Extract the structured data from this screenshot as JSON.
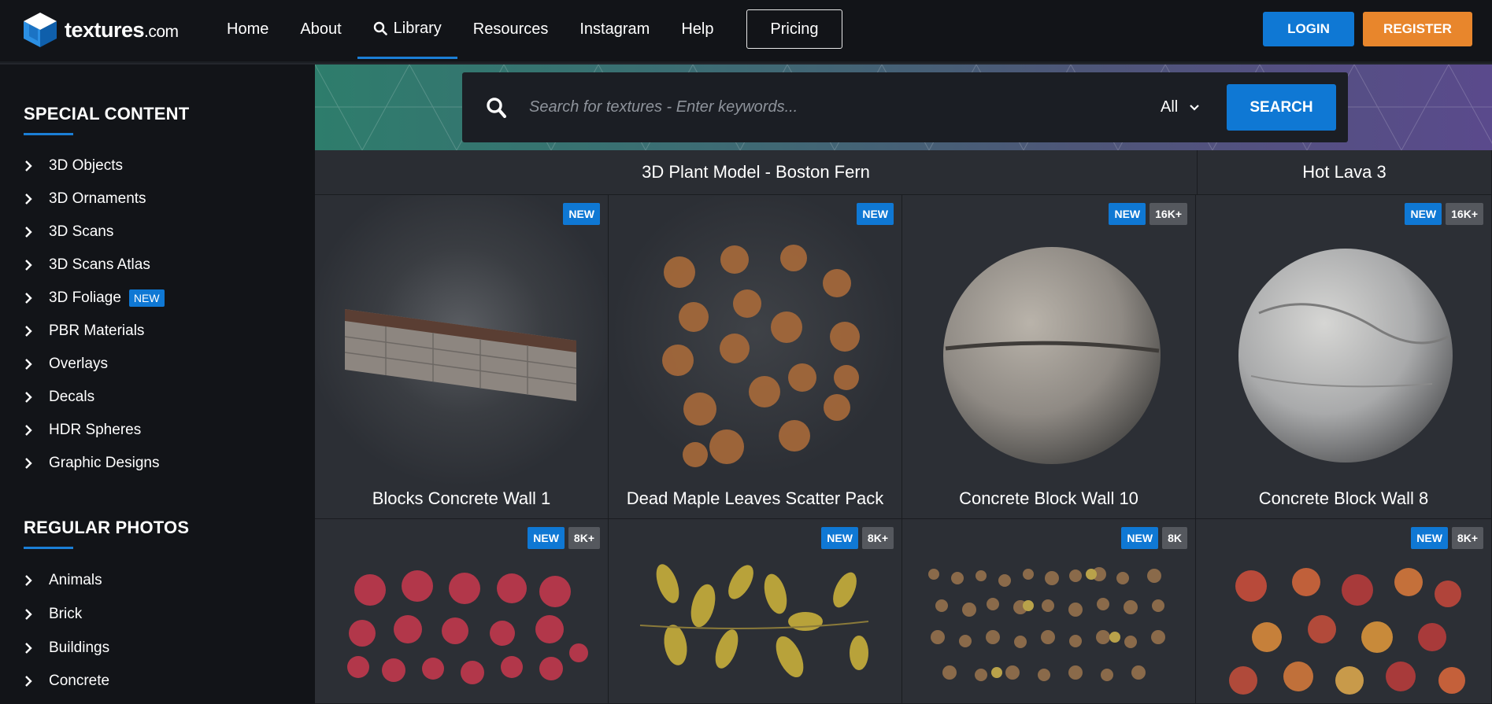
{
  "brand": {
    "name": "textures",
    "suffix": ".com"
  },
  "nav": {
    "items": [
      {
        "label": "Home"
      },
      {
        "label": "About"
      },
      {
        "label": "Library",
        "active": true
      },
      {
        "label": "Resources"
      },
      {
        "label": "Instagram"
      },
      {
        "label": "Help"
      }
    ],
    "pricing": "Pricing",
    "login": "LOGIN",
    "register": "REGISTER"
  },
  "sidebar": {
    "special_heading": "SPECIAL CONTENT",
    "special_items": [
      {
        "label": "3D Objects"
      },
      {
        "label": "3D Ornaments"
      },
      {
        "label": "3D Scans"
      },
      {
        "label": "3D Scans Atlas"
      },
      {
        "label": "3D Foliage",
        "badge": "NEW"
      },
      {
        "label": "PBR Materials"
      },
      {
        "label": "Overlays"
      },
      {
        "label": "Decals"
      },
      {
        "label": "HDR Spheres"
      },
      {
        "label": "Graphic Designs"
      }
    ],
    "regular_heading": "REGULAR PHOTOS",
    "regular_items": [
      {
        "label": "Animals"
      },
      {
        "label": "Brick"
      },
      {
        "label": "Buildings"
      },
      {
        "label": "Concrete"
      }
    ]
  },
  "search": {
    "placeholder": "Search for textures - Enter keywords...",
    "scope": "All",
    "button": "SEARCH"
  },
  "featured": [
    {
      "title": "3D Plant Model - Boston Fern"
    },
    {
      "title": "Hot Lava 3"
    }
  ],
  "cards": [
    {
      "title": "Blocks Concrete Wall 1",
      "badges": [
        "NEW"
      ]
    },
    {
      "title": "Dead Maple Leaves Scatter Pack",
      "badges": [
        "NEW"
      ]
    },
    {
      "title": "Concrete Block Wall 10",
      "badges": [
        "NEW",
        "16K+"
      ]
    },
    {
      "title": "Concrete Block Wall 8",
      "badges": [
        "NEW",
        "16K+"
      ]
    },
    {
      "title": "",
      "badges": [
        "NEW",
        "8K+"
      ]
    },
    {
      "title": "",
      "badges": [
        "NEW",
        "8K+"
      ]
    },
    {
      "title": "",
      "badges": [
        "NEW",
        "8K"
      ]
    },
    {
      "title": "",
      "badges": [
        "NEW",
        "8K+"
      ]
    }
  ],
  "colors": {
    "accent_blue": "#0f78d4",
    "register_orange": "#e8862c",
    "topbar_bg": "#121418",
    "grid_bg": "#2c2f35"
  }
}
